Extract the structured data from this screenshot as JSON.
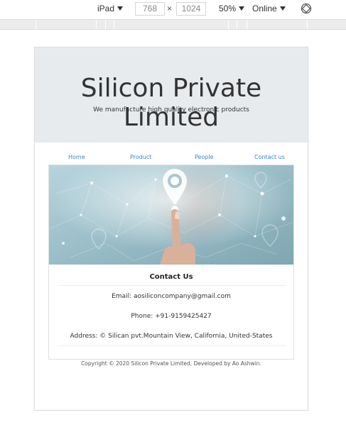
{
  "devtools": {
    "device": "iPad",
    "width": "768",
    "height": "1024",
    "times": "×",
    "zoom": "50%",
    "network": "Online"
  },
  "site": {
    "title": "Silicon Private Limited",
    "tagline": "We manufacture high quality electronic products",
    "nav": [
      "Home",
      "Product",
      "People",
      "Contact us"
    ],
    "contact": {
      "heading": "Contact Us",
      "email": "Email: aosiliconcompany@gmail.com",
      "phone": "Phone: +91-9159425427",
      "address": "Address: © Silican pvt.Mountain View, California, United-States"
    },
    "footer": "Copyright © 2020 Silicon Private Limited, Developed by Ao Ashwin.",
    "colors": {
      "link": "#3b7fe0",
      "jumbotron": "#e8ebee"
    }
  }
}
